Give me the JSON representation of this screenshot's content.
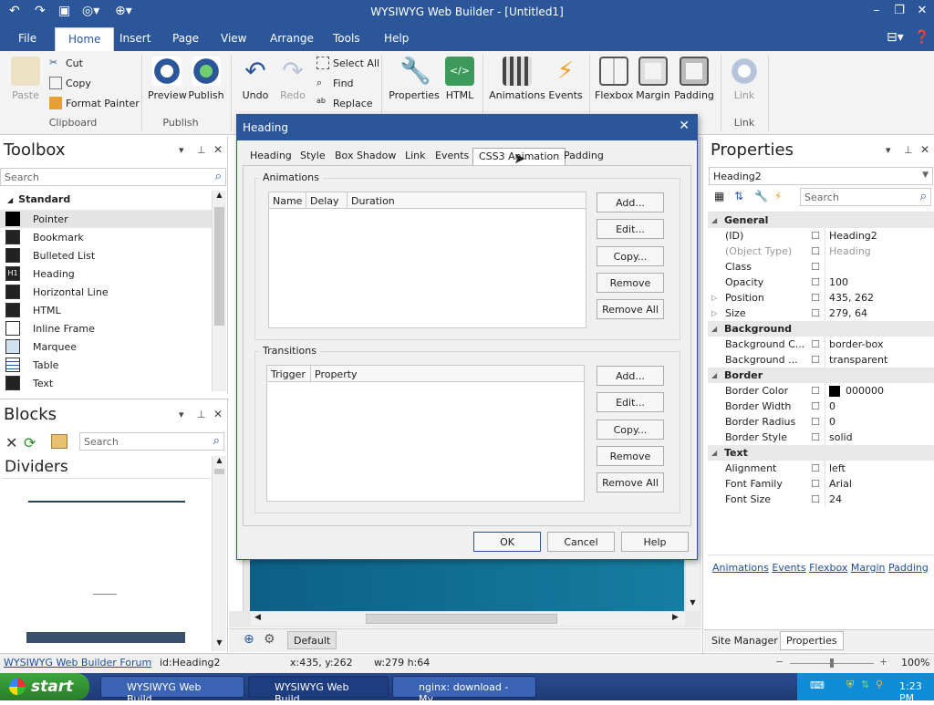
{
  "window": {
    "title": "WYSIWYG Web Builder - [Untitled1]"
  },
  "menu": [
    "File",
    "Home",
    "Insert",
    "Page",
    "View",
    "Arrange",
    "Tools",
    "Help"
  ],
  "ribbon": {
    "clipboard": {
      "paste": "Paste",
      "cut": "Cut",
      "copy": "Copy",
      "format_painter": "Format Painter",
      "group": "Clipboard"
    },
    "publish": {
      "preview": "Preview",
      "publish": "Publish",
      "group": "Publish"
    },
    "edit": {
      "undo": "Undo",
      "redo": "Redo",
      "select_all": "Select All",
      "find": "Find",
      "replace": "Replace"
    },
    "props": {
      "properties": "Properties",
      "html": "HTML"
    },
    "anim": {
      "animations": "Animations",
      "events": "Events"
    },
    "layout": {
      "flexbox": "Flexbox",
      "margin": "Margin",
      "padding": "Padding"
    },
    "link": {
      "link": "Link",
      "group": "Link"
    }
  },
  "toolbox": {
    "title": "Toolbox",
    "search": "Search",
    "section": "Standard",
    "items": [
      "Pointer",
      "Bookmark",
      "Bulleted List",
      "Heading",
      "Horizontal Line",
      "HTML",
      "Inline Frame",
      "Marquee",
      "Table",
      "Text"
    ]
  },
  "blocks": {
    "title": "Blocks",
    "search": "Search",
    "category": "Dividers"
  },
  "dialog": {
    "title": "Heading",
    "tabs": [
      "Heading",
      "Style",
      "Box Shadow",
      "Link",
      "Events",
      "CSS3 Animation",
      "Padding"
    ],
    "animations": {
      "legend": "Animations",
      "cols": [
        "Name",
        "Delay",
        "Duration"
      ]
    },
    "transitions": {
      "legend": "Transitions",
      "cols": [
        "Trigger",
        "Property"
      ]
    },
    "buttons": {
      "add": "Add...",
      "edit": "Edit...",
      "copy": "Copy...",
      "remove": "Remove",
      "remove_all": "Remove All"
    },
    "ok": "OK",
    "cancel": "Cancel",
    "help": "Help"
  },
  "properties": {
    "title": "Properties",
    "object": "Heading2",
    "search": "Search",
    "rows": [
      {
        "label": "General",
        "cat": true
      },
      {
        "label": "(ID)",
        "value": "Heading2"
      },
      {
        "label": "(Object Type)",
        "value": "Heading",
        "dim": true
      },
      {
        "label": "Class",
        "value": ""
      },
      {
        "label": "Opacity",
        "value": "100"
      },
      {
        "label": "Position",
        "value": "435, 262",
        "exp": true
      },
      {
        "label": "Size",
        "value": "279, 64",
        "exp": true
      },
      {
        "label": "Background",
        "cat": true
      },
      {
        "label": "Background C...",
        "value": "border-box"
      },
      {
        "label": "Background ...",
        "value": "transparent"
      },
      {
        "label": "Border",
        "cat": true
      },
      {
        "label": "Border Color",
        "value": "000000",
        "swatch": "#000000"
      },
      {
        "label": "Border Width",
        "value": "0"
      },
      {
        "label": "Border Radius",
        "value": "0"
      },
      {
        "label": "Border Style",
        "value": "solid"
      },
      {
        "label": "Text",
        "cat": true
      },
      {
        "label": "Alignment",
        "value": "left"
      },
      {
        "label": "Font Family",
        "value": "Arial"
      },
      {
        "label": "Font Size",
        "value": "24"
      }
    ],
    "links": [
      "Animations",
      "Events",
      "Flexbox",
      "Margin",
      "Padding"
    ],
    "bottom_tabs": [
      "Site Manager",
      "Properties"
    ]
  },
  "canvas": {
    "page_tab": "Default"
  },
  "status": {
    "forum": "WYSIWYG Web Builder Forum",
    "id": "id:Heading2",
    "pos": "x:435, y:262",
    "size": "w:279 h:64",
    "zoom": "100%"
  },
  "taskbar": {
    "start": "start",
    "tasks": [
      "WYSIWYG Web Build...",
      "WYSIWYG Web Build...",
      "nginx: download - My..."
    ],
    "clock": "1:23 PM"
  },
  "colors": {
    "accent": "#2b579a",
    "canvas_blue": "#0f6f95"
  }
}
